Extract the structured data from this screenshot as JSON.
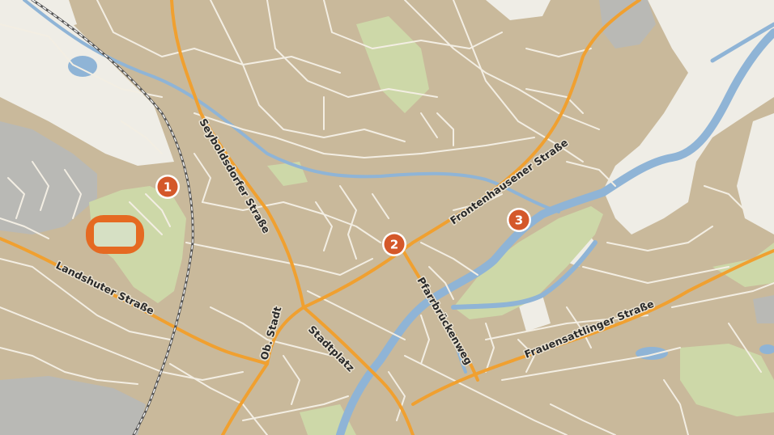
{
  "map": {
    "colors": {
      "land": "#c9b99b",
      "street": "#f3eee3",
      "main_road": "#f0a030",
      "water": "#8fb4d6",
      "park": "#cdd8a8",
      "open_area": "#efede6",
      "industrial": "#b9b9b5",
      "marker": "#d4582a",
      "railway": "#555555"
    },
    "street_labels": [
      {
        "id": "seyboldsdorfer",
        "text": "Seyboldsdorfer Straße"
      },
      {
        "id": "frontenhausener",
        "text": "Frontenhausener Straße"
      },
      {
        "id": "landshuter",
        "text": "Landshuter Straße"
      },
      {
        "id": "pfarrbruecken",
        "text": "Pfarrbrückenweg"
      },
      {
        "id": "frauensattlinger",
        "text": "Frauensattlinger Straße"
      },
      {
        "id": "ob-stadt",
        "text": "Ob. Stadt"
      },
      {
        "id": "stadtplatz",
        "text": "Stadtplatz"
      }
    ],
    "markers": [
      {
        "id": "marker-1",
        "label": "1"
      },
      {
        "id": "marker-2",
        "label": "2"
      },
      {
        "id": "marker-3",
        "label": "3"
      }
    ],
    "feature_icons": [
      "stadium-track-icon",
      "railway-line-icon"
    ]
  }
}
